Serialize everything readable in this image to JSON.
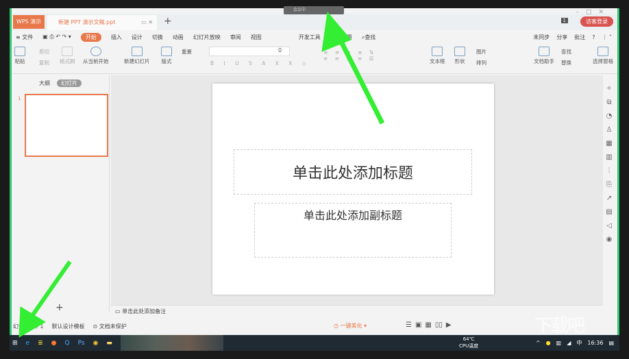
{
  "titlebar": {
    "app_tab": "WPS 演示",
    "doc_tab": "新建 PPT 演示文稿.ppt",
    "new_tab": "+",
    "notification_count": "1",
    "login": "访客登录",
    "floating_label": "会议中"
  },
  "menu": {
    "items": [
      "≡ 文件",
      "开始",
      "插入",
      "设计",
      "切换",
      "动画",
      "幻灯片放映",
      "审阅",
      "视图",
      "开发工具",
      "特色应用",
      "查找"
    ],
    "active": "开始",
    "right": [
      "未同步",
      "分享",
      "批注",
      "?"
    ]
  },
  "toolbar": {
    "paste": "粘贴",
    "cut": "剪切",
    "copy": "复制",
    "format_painter": "格式刷",
    "play_from_current": "从当前开始",
    "new_slide": "新建幻灯片",
    "layout": "版式",
    "reset": "重置",
    "font_size": "0",
    "textbox": "文本框",
    "shape": "形状",
    "picture": "图片",
    "arrange": "排列",
    "doc_assistant": "文档助手",
    "find": "查找",
    "replace": "替换",
    "select_pane": "选择窗格"
  },
  "left_panel": {
    "tabs": [
      "大纲",
      "幻灯片"
    ],
    "active_tab": "幻灯片",
    "slide_number": "1",
    "add": "+"
  },
  "slide": {
    "title_placeholder": "单击此处添加标题",
    "subtitle_placeholder": "单击此处添加副标题"
  },
  "notes": {
    "placeholder": "单击此处添加备注"
  },
  "status": {
    "slide_count": "幻灯片 1 / 1",
    "template": "默认设计模板",
    "protection": "文档未保护",
    "beautify": "一键美化"
  },
  "taskbar": {
    "temperature": "64℃",
    "cpu_label": "CPU温度",
    "ime": "中",
    "time": "16:36"
  },
  "watermark": "下载吧",
  "colors": {
    "accent": "#e8774a",
    "arrow": "#33ee33",
    "taskbar": "#1f2a33"
  }
}
